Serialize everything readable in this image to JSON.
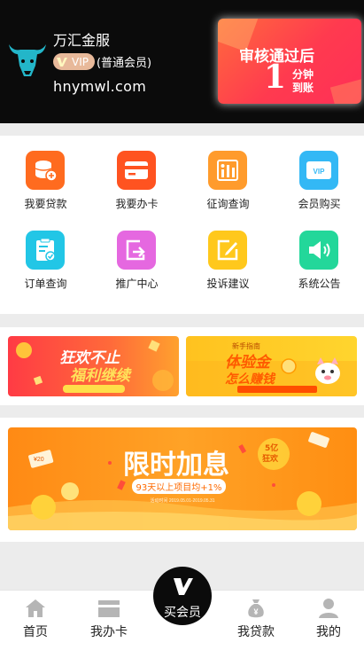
{
  "header": {
    "app_name": "万汇金服",
    "vip_badge": "VIP",
    "member_level": "(普通会员)",
    "domain": "hnymwl.com",
    "promo": {
      "line1": "审核通过后",
      "number": "1",
      "line2": "分钟到账"
    }
  },
  "menu": {
    "items": [
      {
        "label": "我要贷款",
        "icon": "coins-plus-icon",
        "color": "#ff6b1f"
      },
      {
        "label": "我要办卡",
        "icon": "credit-card-icon",
        "color": "#ff5320"
      },
      {
        "label": "征询查询",
        "icon": "bar-chart-icon",
        "color": "#ff9b2c"
      },
      {
        "label": "会员购买",
        "icon": "vip-card-icon",
        "color": "#33b8f5"
      },
      {
        "label": "订单查询",
        "icon": "clipboard-check-icon",
        "color": "#22c6e6"
      },
      {
        "label": "推广中心",
        "icon": "share-screen-icon",
        "color": "#e568e0"
      },
      {
        "label": "投诉建议",
        "icon": "edit-note-icon",
        "color": "#ffc81c"
      },
      {
        "label": "系统公告",
        "icon": "speaker-icon",
        "color": "#23d79a"
      }
    ]
  },
  "banners": {
    "a": {
      "title": "狂欢不止 福利继续",
      "sub": "活动时间 5.18-5.31"
    },
    "b": {
      "tag": "新手指南",
      "title": "体验金 怎么赚钱",
      "sub": "最高年化收益率 10.80%"
    },
    "big": {
      "title": "限时加息",
      "sub": "93天以上项目均+1%",
      "small": "活动时间 2019.05.01-2019.05.31",
      "seal": "5亿狂欢",
      "note": "¥20"
    }
  },
  "tabbar": {
    "items": [
      {
        "label": "首页",
        "icon": "home-icon"
      },
      {
        "label": "我办卡",
        "icon": "card-icon"
      },
      {
        "label": "我贷款",
        "icon": "money-bag-icon"
      },
      {
        "label": "我的",
        "icon": "user-icon"
      }
    ],
    "center": {
      "label": "买会员",
      "icon": "v-logo-icon"
    }
  },
  "colors": {
    "header_bg": "#0b0b0b",
    "page_bg": "#ececec",
    "promo_red": "#ff3a4f"
  }
}
